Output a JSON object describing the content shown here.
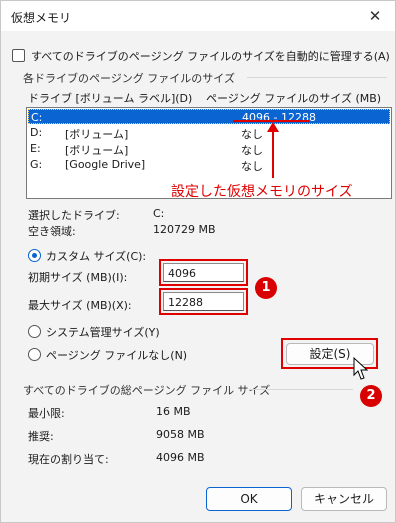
{
  "window": {
    "title": "仮想メモリ",
    "close_glyph": "✕"
  },
  "auto_manage": {
    "label": "すべてのドライブのページング ファイルのサイズを自動的に管理する(A)",
    "checked": false
  },
  "drive_group": {
    "title": "各ドライブのページング ファイルのサイズ",
    "col_drive": "ドライブ [ボリューム ラベル](D)",
    "col_paging": "ページング ファイルのサイズ (MB)",
    "rows": [
      {
        "drive": "C:",
        "label": "",
        "size": "4096 - 12288",
        "selected": true
      },
      {
        "drive": "D:",
        "label": "[ボリューム]",
        "size": "なし",
        "selected": false
      },
      {
        "drive": "E:",
        "label": "[ボリューム]",
        "size": "なし",
        "selected": false
      },
      {
        "drive": "G:",
        "label": "[Google Drive]",
        "size": "なし",
        "selected": false
      }
    ],
    "annotation": "設定した仮想メモリのサイズ",
    "selected_drive_label": "選択したドライブ:",
    "selected_drive_value": "C:",
    "free_space_label": "空き領域:",
    "free_space_value": "120729 MB",
    "custom_size_label": "カスタム サイズ(C):",
    "initial_size_label": "初期サイズ (MB)(I):",
    "initial_size_value": "4096",
    "max_size_label": "最大サイズ (MB)(X):",
    "max_size_value": "12288",
    "system_managed_label": "システム管理サイズ(Y)",
    "no_paging_label": "ページング ファイルなし(N)",
    "set_button": "設定(S)",
    "selected_option": "custom"
  },
  "badges": {
    "one": "1",
    "two": "2"
  },
  "total_group": {
    "title": "すべてのドライブの総ページング ファイル サイズ",
    "minimum_label": "最小限:",
    "minimum_value": "16 MB",
    "recommended_label": "推奨:",
    "recommended_value": "9058 MB",
    "current_label": "現在の割り当て:",
    "current_value": "4096 MB"
  },
  "buttons": {
    "ok": "OK",
    "cancel": "キャンセル"
  },
  "colors": {
    "selection": "#0a64d2",
    "annotation_red": "#e00000"
  }
}
